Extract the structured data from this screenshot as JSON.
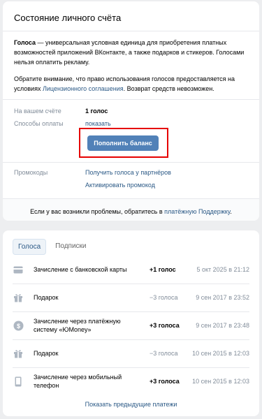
{
  "header": {
    "title": "Состояние личного счёта"
  },
  "intro": {
    "term": "Голоса",
    "text": " — универсальная условная единица для приобретения платных возможностей приложений ВКонтакте, а также подарков и стикеров. Голосами нельзя оплатить рекламу.",
    "notice_prefix": "Обратите внимание, что право использования голосов предоставляется на условиях ",
    "notice_link": "Лицензионного соглашения",
    "notice_suffix": ". Возврат средств невозможен."
  },
  "account": {
    "balance_label": "На вашем счёте",
    "balance_value": "1 голос",
    "payment_label": "Способы оплаты",
    "payment_link": "показать",
    "topup_button": "Пополнить баланс"
  },
  "promo": {
    "label": "Промокоды",
    "link1": "Получить голоса у партнёров",
    "link2": "Активировать промокод"
  },
  "support": {
    "prefix": "Если у вас возникли проблемы, обратитесь в ",
    "link": "платёжную Поддержку",
    "suffix": "."
  },
  "tabs": [
    {
      "label": "Голоса",
      "active": true
    },
    {
      "label": "Подписки",
      "active": false
    }
  ],
  "transactions": [
    {
      "icon": "card-icon",
      "name": "Зачисление с банковской карты",
      "amount": "+1 голос",
      "sign": "plus",
      "date": "5 окт 2025 в 21:12"
    },
    {
      "icon": "gift-icon",
      "name": "Подарок",
      "amount": "−3 голоса",
      "sign": "minus",
      "date": "9 сен 2017 в 23:52"
    },
    {
      "icon": "ruble-icon",
      "name": "Зачисление через платёжную систему «ЮMoney»",
      "amount": "+3 голоса",
      "sign": "plus",
      "date": "9 сен 2017 в 23:48"
    },
    {
      "icon": "gift-icon",
      "name": "Подарок",
      "amount": "−3 голоса",
      "sign": "minus",
      "date": "10 сен 2015 в 12:03"
    },
    {
      "icon": "phone-icon",
      "name": "Зачисление через мобильный телефон",
      "amount": "+3 голоса",
      "sign": "plus",
      "date": "10 сен 2015 в 12:03"
    }
  ],
  "more_link": "Показать предыдущие платежи",
  "colors": {
    "accent": "#5181b8",
    "link": "#2a5885",
    "highlight": "#e60000",
    "muted": "#818c99",
    "background": "#edeef0"
  }
}
